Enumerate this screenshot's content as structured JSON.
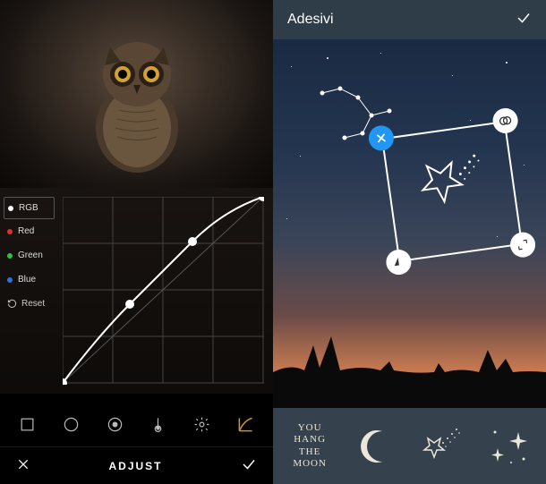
{
  "left": {
    "channels": {
      "rgb": "RGB",
      "red": "Red",
      "green": "Green",
      "blue": "Blue"
    },
    "reset": "Reset",
    "bottom_title": "ADJUST",
    "colors": {
      "rgb": "#ffffff",
      "red": "#e03030",
      "green": "#30c040",
      "blue": "#3070e0"
    }
  },
  "right": {
    "header_title": "Adesivi",
    "stickers": {
      "hang_line1": "YOU",
      "hang_line2": "HANG",
      "hang_line3": "THE",
      "hang_line4": "MOON"
    }
  }
}
